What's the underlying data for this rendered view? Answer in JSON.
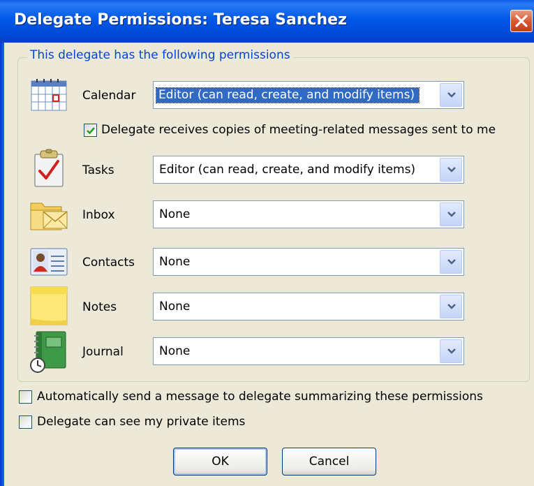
{
  "window": {
    "title": "Delegate Permissions: Teresa Sanchez",
    "close_tooltip_icon": "close-icon"
  },
  "group": {
    "label": "This delegate has the following permissions"
  },
  "permissions": [
    {
      "label": "Calendar",
      "value": "Editor (can read, create, and modify items)",
      "icon": "calendar-icon"
    },
    {
      "label": "Tasks",
      "value": "Editor (can read, create, and modify items)",
      "icon": "tasks-icon"
    },
    {
      "label": "Inbox",
      "value": "None",
      "icon": "inbox-icon"
    },
    {
      "label": "Contacts",
      "value": "None",
      "icon": "contacts-icon"
    },
    {
      "label": "Notes",
      "value": "None",
      "icon": "notes-icon"
    },
    {
      "label": "Journal",
      "value": "None",
      "icon": "journal-icon"
    }
  ],
  "options": {
    "meeting_copies": {
      "label": "Delegate receives copies of meeting-related messages sent to me",
      "checked": true
    },
    "auto_summary": {
      "label": "Automatically send a message to delegate summarizing these permissions",
      "checked": false
    },
    "private_items": {
      "label": "Delegate can see my private items",
      "checked": false
    }
  },
  "buttons": {
    "ok": "OK",
    "cancel": "Cancel"
  },
  "colors": {
    "titlebar": "#0058e6",
    "group_label": "#0046d5",
    "selection": "#316ac5",
    "dialog_bg": "#ece9d8"
  }
}
